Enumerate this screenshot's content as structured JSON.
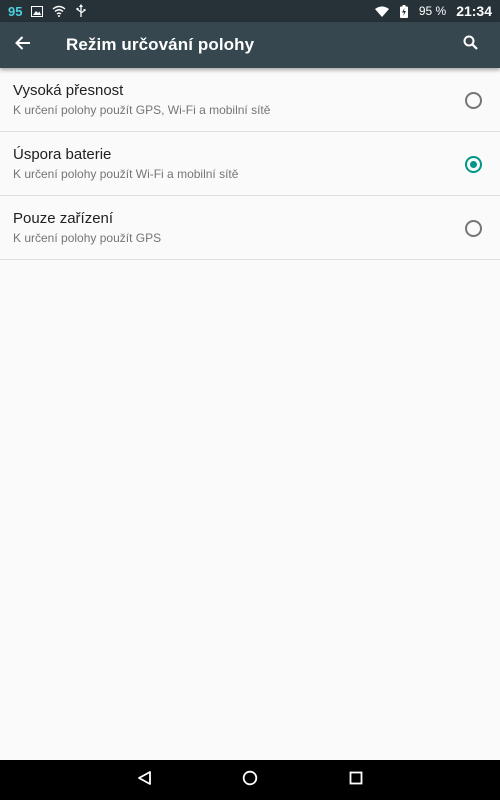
{
  "status_bar": {
    "notification_count": "95",
    "battery_percent": "95 %",
    "time": "21:34",
    "icons": [
      "image-icon",
      "wifi-icon",
      "usb-icon",
      "wifi-signal-icon",
      "battery-charging-icon"
    ]
  },
  "app_bar": {
    "title": "Režim určování polohy",
    "back_icon": "arrow-left-icon",
    "search_icon": "search-icon"
  },
  "location_modes": [
    {
      "title": "Vysoká přesnost",
      "subtitle": "K určení polohy použít GPS, Wi-Fi a mobilní sítě",
      "selected": false
    },
    {
      "title": "Úspora baterie",
      "subtitle": "K určení polohy použít Wi-Fi a mobilní sítě",
      "selected": true
    },
    {
      "title": "Pouze zařízení",
      "subtitle": "K určení polohy použít GPS",
      "selected": false
    }
  ],
  "nav_bar": {
    "icons": [
      "back-triangle-icon",
      "home-circle-icon",
      "recents-square-icon"
    ]
  },
  "colors": {
    "status_bar_bg": "#263238",
    "app_bar_bg": "#37474f",
    "accent": "#009688",
    "background": "#fafafa"
  }
}
